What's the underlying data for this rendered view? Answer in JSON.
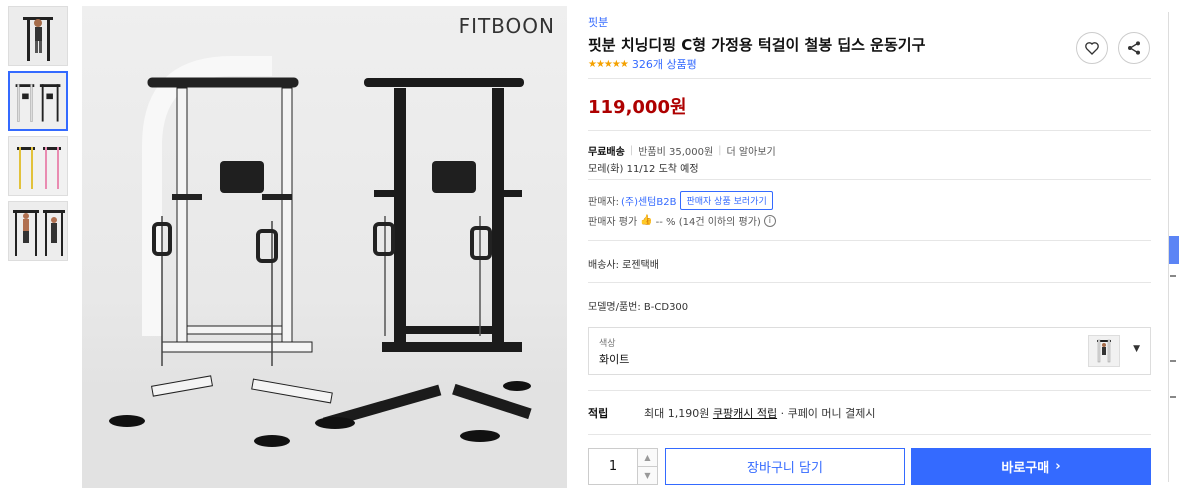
{
  "logo": "FITBOON",
  "product": {
    "brand": "핏분",
    "title": "핏분 치닝디핑 C형 가정용 턱걸이 철봉 딥스 운동기구",
    "rating_stars": 4.5,
    "review_count": "326개 상품평",
    "price": "119,000원"
  },
  "shipping": {
    "free_label": "무료배송",
    "return_fee": "반품비 35,000원",
    "more_link": "더 알아보기",
    "arrival": "모레(화) 11/12 도착 예정",
    "courier": "배송사: 로젠택배"
  },
  "seller": {
    "label": "판매자:",
    "name": "(주)센텀B2B",
    "more_button": "판매자 상품 보러가기",
    "rating_label": "판매자 평가",
    "rating_value": "-- % (14건 이하의 평가)"
  },
  "model": "모델명/품번: B-CD300",
  "option": {
    "label": "색상",
    "value": "화이트"
  },
  "points": {
    "label": "적립",
    "prefix": "최대 1,190원",
    "link": "쿠팡캐시 적립",
    "suffix": "· 쿠페이 머니 결제시"
  },
  "purchase": {
    "quantity": "1",
    "cart_button": "장바구니 담기",
    "buy_button": "바로구매"
  },
  "colors": {
    "accent": "#346aff",
    "price": "#ae0000",
    "star": "#f4a100"
  }
}
